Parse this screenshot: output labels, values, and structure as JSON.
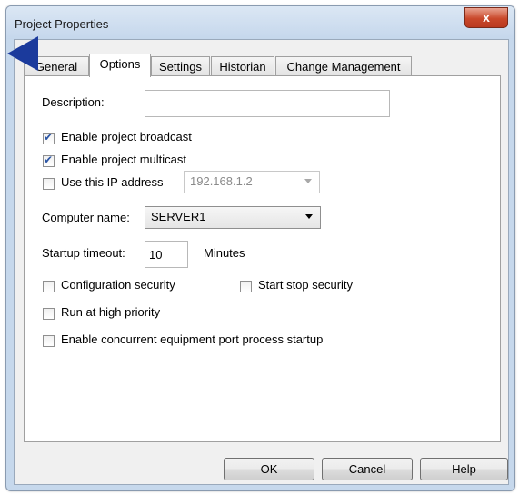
{
  "window": {
    "title": "Project Properties",
    "close_label": "x"
  },
  "tabs": [
    {
      "label": "General"
    },
    {
      "label": "Options"
    },
    {
      "label": "Settings"
    },
    {
      "label": "Historian"
    },
    {
      "label": "Change Management"
    }
  ],
  "active_tab": "Options",
  "options": {
    "description_label": "Description:",
    "description_value": "",
    "broadcast_label": "Enable project broadcast",
    "multicast_label": "Enable project multicast",
    "use_ip_label": "Use this IP address",
    "ip_value": "192.168.1.2",
    "computer_name_label": "Computer name:",
    "computer_name_value": "SERVER1",
    "startup_timeout_label": "Startup timeout:",
    "startup_timeout_value": "10",
    "minutes_label": "Minutes",
    "config_security_label": "Configuration security",
    "start_stop_security_label": "Start stop security",
    "high_priority_label": "Run at high priority",
    "concurrent_label": "Enable concurrent equipment port process startup"
  },
  "checkbox_states": {
    "broadcast": true,
    "multicast": true,
    "use_ip": false,
    "config_security": false,
    "start_stop_security": false,
    "high_priority": false,
    "concurrent": false
  },
  "buttons": {
    "ok": "OK",
    "cancel": "Cancel",
    "help": "Help"
  },
  "colors": {
    "pointer": "#1b3a9c",
    "close_button": "#c9482b",
    "checkmark": "#2a54a4"
  }
}
